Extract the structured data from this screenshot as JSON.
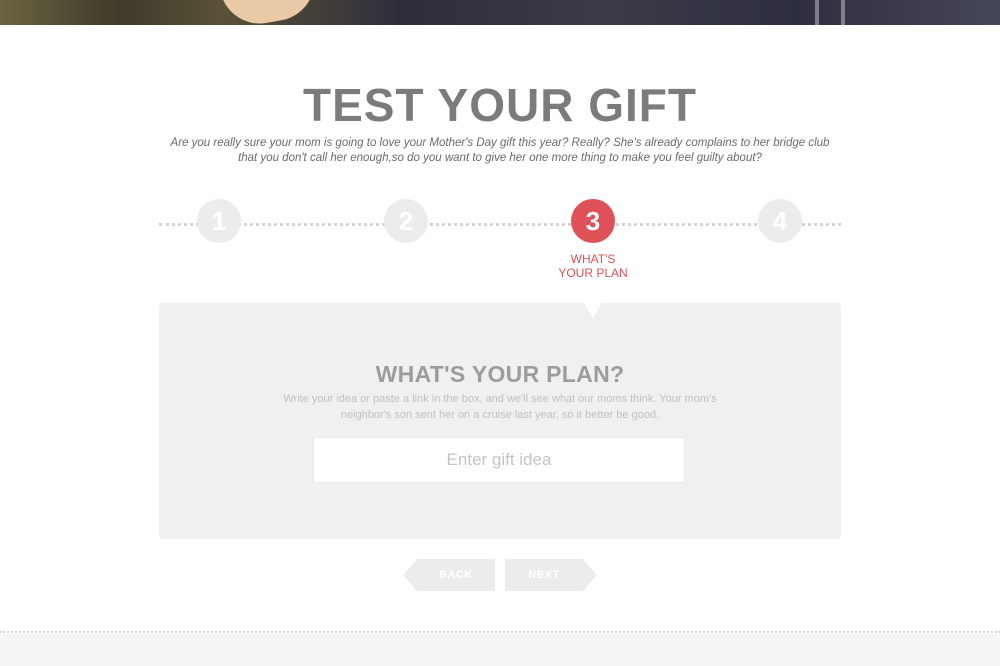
{
  "header": {
    "title": "TEST YOUR GIFT",
    "subtitle_line1": "Are you really sure your mom is going to love your Mother's Day gift this year? Really? She's already complains to her bridge club",
    "subtitle_line2": "that you don't call her enough,so do you want to give her one more thing to make you feel guilty about?"
  },
  "steps": [
    {
      "number": "1",
      "label": ""
    },
    {
      "number": "2",
      "label": ""
    },
    {
      "number": "3",
      "label_line1": "WHAT'S",
      "label_line2": "YOUR PLAN",
      "active": true
    },
    {
      "number": "4",
      "label": ""
    }
  ],
  "panel": {
    "title": "WHAT'S YOUR PLAN?",
    "desc_line1": "Write your idea or paste a link in the box, and we'll see what our moms think. Your mom's",
    "desc_line2": "neighbor's son sent her on a cruise last year, so it better be good.",
    "input_placeholder": "Enter gift idea",
    "input_value": ""
  },
  "nav": {
    "back_label": "BACK",
    "next_label": "NEXT"
  },
  "colors": {
    "accent": "#df5158",
    "step_inactive": "#ececec",
    "panel_bg": "#f0f0f0",
    "title": "#7b7b7b"
  }
}
